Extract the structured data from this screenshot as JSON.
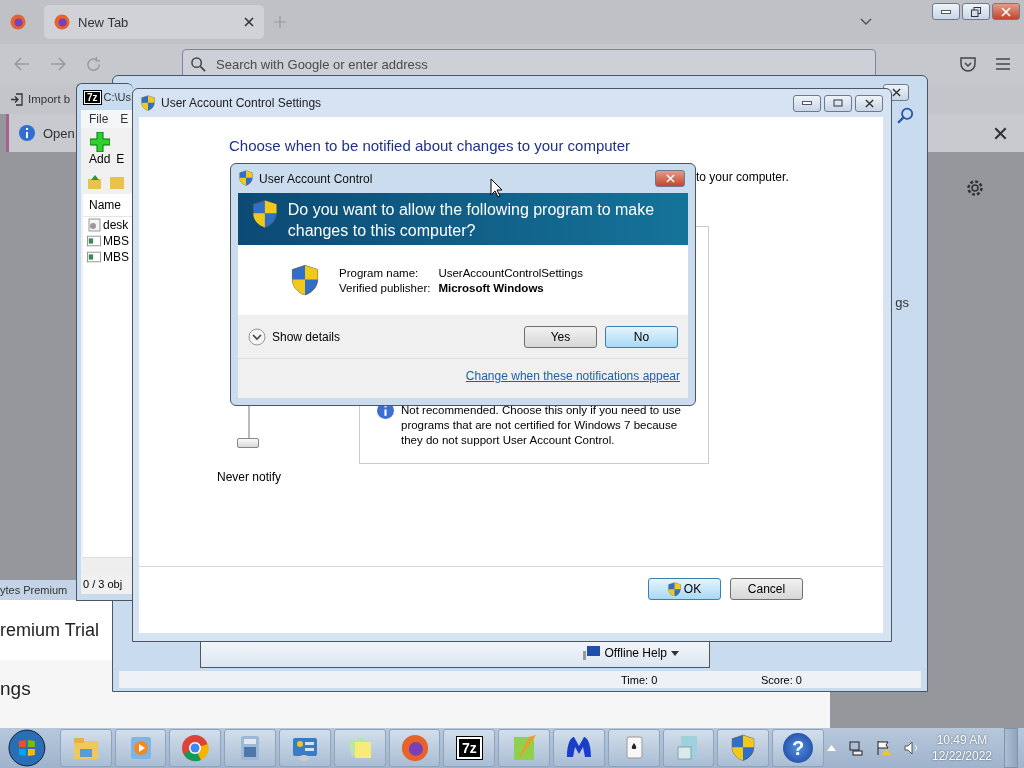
{
  "browser": {
    "tab": {
      "label": "New Tab",
      "selected": true
    },
    "address_bar": {
      "placeholder": "Search with Google or enter address"
    },
    "bookmark": "Import b",
    "notification": "Open"
  },
  "background_app": {
    "title": "ytes Premium",
    "card": "remium Trial",
    "heading": "ngs",
    "side_text": "gs"
  },
  "games_window": {
    "time": "Time:   0",
    "score": "Score: 0"
  },
  "help_bar": {
    "menu": "Offline Help"
  },
  "archive_window": {
    "logo": "7z",
    "title": "C:\\Us",
    "menu": [
      "File",
      "E"
    ],
    "toolbar": [
      "Add",
      "E"
    ],
    "column": "Name",
    "files": [
      {
        "kind": "settings",
        "name": "desk"
      },
      {
        "kind": "file",
        "name": "MBS"
      },
      {
        "kind": "file",
        "name": "MBS"
      }
    ],
    "status": "0 / 3 obj"
  },
  "uac_settings": {
    "title": "User Account Control Settings",
    "heading": "Choose when to be notified about changes to your computer",
    "fragment": "to your computer.",
    "slider": {
      "label": "Never notify",
      "level": 0
    },
    "info": "Not recommended. Choose this only if you need to use programs that are not certified for Windows 7 because they do not support User Account Control.",
    "buttons": [
      {
        "label": "OK",
        "shield": true,
        "selected": true
      },
      {
        "label": "Cancel",
        "shield": false,
        "selected": false
      }
    ]
  },
  "uac_prompt": {
    "title": "User Account Control",
    "question": "Do you want to allow the following program to make changes to this computer?",
    "fields": [
      {
        "label": "Program name:",
        "value": "UserAccountControlSettings",
        "bold": false
      },
      {
        "label": "Verified publisher:",
        "value": "Microsoft Windows",
        "bold": true
      }
    ],
    "details": "Show details",
    "buttons": [
      {
        "label": "Yes",
        "selected": false
      },
      {
        "label": "No",
        "selected": true
      }
    ],
    "link": "Change when these notifications appear"
  },
  "taskbar": {
    "apps": [
      {
        "kind": "explorer"
      },
      {
        "kind": "media"
      },
      {
        "kind": "chrome"
      },
      {
        "kind": "calculator"
      },
      {
        "kind": "control"
      },
      {
        "kind": "notes"
      },
      {
        "kind": "firefox"
      },
      {
        "kind": "archive",
        "label": "7z"
      },
      {
        "kind": "editor"
      },
      {
        "kind": "malware"
      },
      {
        "kind": "cards"
      },
      {
        "kind": "document"
      },
      {
        "kind": "shield"
      },
      {
        "kind": "help",
        "label": "?"
      }
    ],
    "clock": {
      "time": "10:49 AM",
      "date": "12/22/2022"
    }
  }
}
